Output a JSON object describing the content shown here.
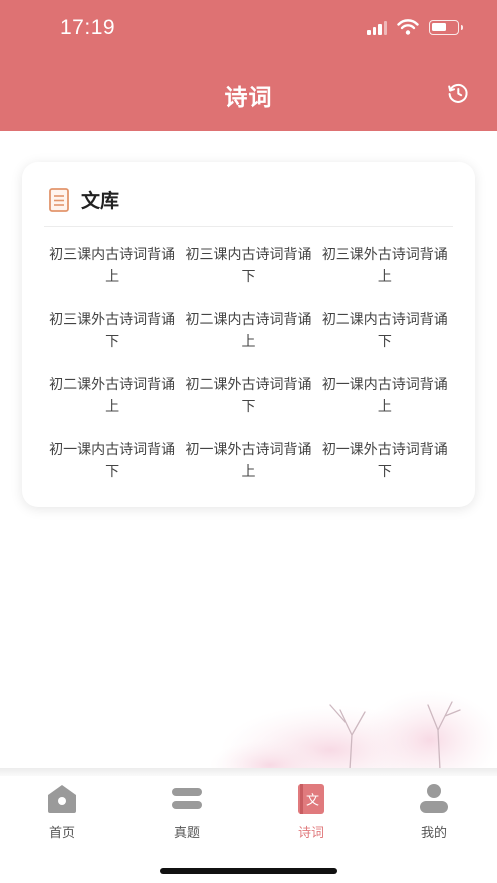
{
  "status_bar": {
    "time": "17:19"
  },
  "header": {
    "title": "诗词",
    "history_icon": "history-clock-icon"
  },
  "library": {
    "title": "文库",
    "icon": "document-icon",
    "items": [
      "初三课内古诗词背诵 上",
      "初三课内古诗词背诵 下",
      "初三课外古诗词背诵 上",
      "初三课外古诗词背诵 下",
      "初二课内古诗词背诵 上",
      "初二课内古诗词背诵 下",
      "初二课外古诗词背诵 上",
      "初二课外古诗词背诵 下",
      "初一课内古诗词背诵 上",
      "初一课内古诗词背诵 下",
      "初一课外古诗词背诵 上",
      "初一课外古诗词背诵 下"
    ]
  },
  "tabs": [
    {
      "label": "首页",
      "icon": "home-icon",
      "active": false
    },
    {
      "label": "真题",
      "icon": "papers-icon",
      "active": false
    },
    {
      "label": "诗词",
      "icon": "poetry-book-icon",
      "active": true,
      "icon_char": "文"
    },
    {
      "label": "我的",
      "icon": "user-icon",
      "active": false
    }
  ],
  "colors": {
    "header": "#de7273",
    "accent": "#e07a7d",
    "inactive_icon": "#9a9a9a"
  }
}
